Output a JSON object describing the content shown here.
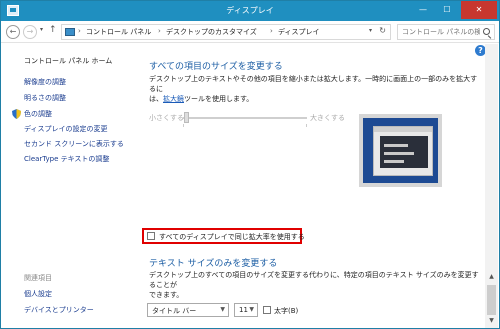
{
  "window": {
    "title": "ディスプレイ",
    "minimize": "—",
    "maximize": "☐",
    "close": "✕"
  },
  "address": {
    "back": "←",
    "forward": "→",
    "recent": "▾",
    "up": "↑",
    "crumbs": [
      "コントロール パネル",
      "デスクトップのカスタマイズ",
      "ディスプレイ"
    ],
    "sep": "›",
    "dropdown": "▾",
    "refresh": "↻",
    "search_placeholder": "コントロール パネルの検索"
  },
  "help": "?",
  "sidebar": {
    "home": "コントロール パネル ホーム",
    "links": [
      "解像度の調整",
      "明るさの調整",
      "色の調整",
      "ディスプレイの設定の変更",
      "セカンド スクリーンに表示する",
      "ClearType テキストの調整"
    ],
    "see_also": "関連項目",
    "related": [
      "個人設定",
      "デバイスとプリンター"
    ]
  },
  "main": {
    "heading1": "すべての項目のサイズを変更する",
    "desc1_line1": "デスクトップ上のテキストやその他の項目を縮小または拡大します。一時的に画面上の一部のみを拡大するに",
    "desc1_pre": "は、",
    "desc1_link": "拡大鏡",
    "desc1_post": "ツールを使用します。",
    "slider_small": "小さくする",
    "slider_large": "大きくする",
    "same_scale_label": "すべてのディスプレイで同じ拡大率を使用する",
    "heading2": "テキスト サイズのみを変更する",
    "desc2_line1": "デスクトップ上のすべての項目のサイズを変更する代わりに、特定の項目のテキスト サイズのみを変更することが",
    "desc2_line2": "できます。",
    "item_select": "タイトル バー",
    "size_select": "11",
    "bold_label": "太字(B)"
  },
  "scroll": {
    "up": "▲",
    "down": "▼"
  }
}
